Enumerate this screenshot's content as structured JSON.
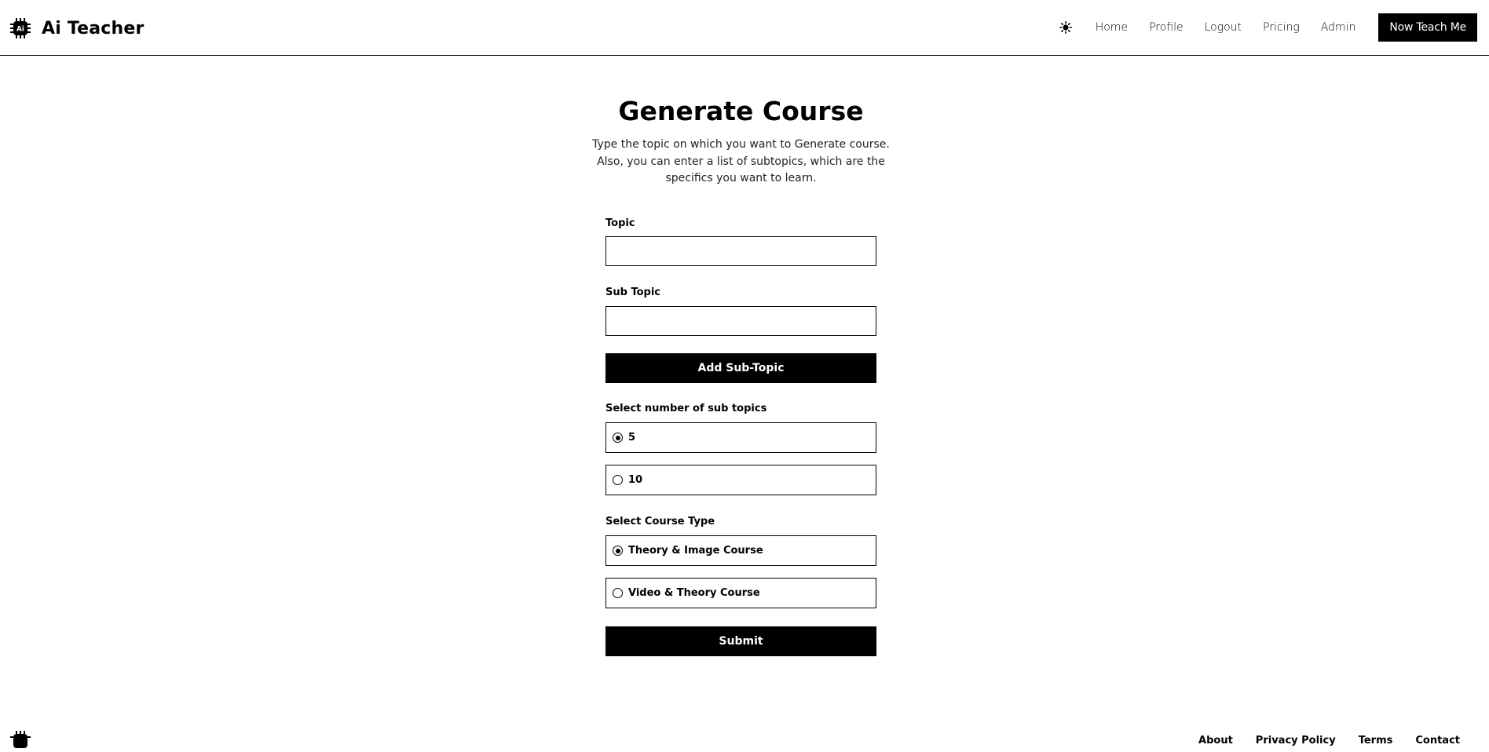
{
  "header": {
    "brand_name": "Ai Teacher",
    "logo_text": "Ai",
    "theme_icon": "sun-icon",
    "nav": [
      "Home",
      "Profile",
      "Logout",
      "Pricing",
      "Admin"
    ],
    "cta_label": "Now Teach Me"
  },
  "main": {
    "title": "Generate Course",
    "description_lines": [
      "Type the topic on which you want to Generate course.",
      "Also, you can enter a list of subtopics, which are the",
      "specifics you want to learn."
    ],
    "topic_label": "Topic",
    "topic_value": "",
    "subtopic_label": "Sub Topic",
    "subtopic_value": "",
    "add_subtopic_label": "Add Sub-Topic",
    "subtopic_count_label": "Select number of sub topics",
    "subtopic_count_options": [
      "5",
      "10"
    ],
    "subtopic_count_selected": "5",
    "course_type_label": "Select Course Type",
    "course_type_options": [
      "Theory & Image Course",
      "Video & Theory Course"
    ],
    "course_type_selected": "Theory & Image Course",
    "submit_label": "Submit"
  },
  "footer": {
    "links": [
      "About",
      "Privacy Policy",
      "Terms",
      "Contact"
    ]
  },
  "colors": {
    "primary": "#000000",
    "background": "#ffffff"
  }
}
